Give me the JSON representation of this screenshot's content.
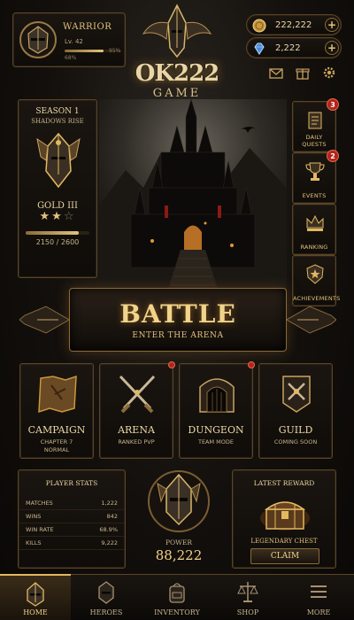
{
  "player": {
    "name": "WARRIOR",
    "level": "Lv. 42",
    "xp_left": "68%",
    "xp_right": "95%",
    "xp_fraction": 0.68
  },
  "currency": {
    "gold": "222,222",
    "gems": "2,222"
  },
  "logo": {
    "line1": "OK222",
    "line2": "GAME"
  },
  "season": {
    "title": "SEASON 1",
    "subtitle": "SHADOWS RISE",
    "rank": "GOLD III",
    "stars_filled": 2,
    "stars_total": 3,
    "progress": "2150 / 2600",
    "progress_fraction": 0.83
  },
  "side_menu": [
    {
      "label": "DAILY QUESTS",
      "icon": "scroll-icon",
      "badge": "3"
    },
    {
      "label": "EVENTS",
      "icon": "trophy-icon",
      "badge": "2"
    },
    {
      "label": "RANKING",
      "icon": "crown-icon",
      "badge": ""
    },
    {
      "label": "ACHIEVEMENTS",
      "icon": "star-shield-icon",
      "badge": ""
    }
  ],
  "battle": {
    "title": "BATTLE",
    "subtitle": "ENTER THE ARENA"
  },
  "modes": [
    {
      "title": "CAMPAIGN",
      "sub1": "CHAPTER 7",
      "sub2": "NORMAL",
      "icon": "map-icon",
      "dot": false
    },
    {
      "title": "ARENA",
      "sub1": "RANKED PVP",
      "sub2": "",
      "icon": "crossed-swords-icon",
      "dot": true
    },
    {
      "title": "DUNGEON",
      "sub1": "TEAM MODE",
      "sub2": "",
      "icon": "gate-icon",
      "dot": true
    },
    {
      "title": "GUILD",
      "sub1": "COMING SOON",
      "sub2": "",
      "icon": "guild-banner-icon",
      "dot": false
    }
  ],
  "stats": {
    "title": "PLAYER STATS",
    "rows": [
      {
        "label": "MATCHES",
        "value": "1,222"
      },
      {
        "label": "WINS",
        "value": "842"
      },
      {
        "label": "WIN RATE",
        "value": "68.9%"
      },
      {
        "label": "KILLS",
        "value": "9,222"
      }
    ]
  },
  "power": {
    "label": "POWER",
    "value": "88,222"
  },
  "reward": {
    "title": "LATEST REWARD",
    "name": "LEGENDARY CHEST",
    "button": "CLAIM"
  },
  "nav": [
    {
      "label": "HOME",
      "icon": "helmet-home-icon",
      "active": true
    },
    {
      "label": "HEROES",
      "icon": "helmet-icon",
      "active": false
    },
    {
      "label": "INVENTORY",
      "icon": "backpack-icon",
      "active": false
    },
    {
      "label": "SHOP",
      "icon": "scales-icon",
      "active": false
    },
    {
      "label": "MORE",
      "icon": "menu-icon",
      "active": false
    }
  ],
  "colors": {
    "gold": "#e2c37c",
    "accent_red": "#b3241c",
    "background": "#0c0a08"
  }
}
